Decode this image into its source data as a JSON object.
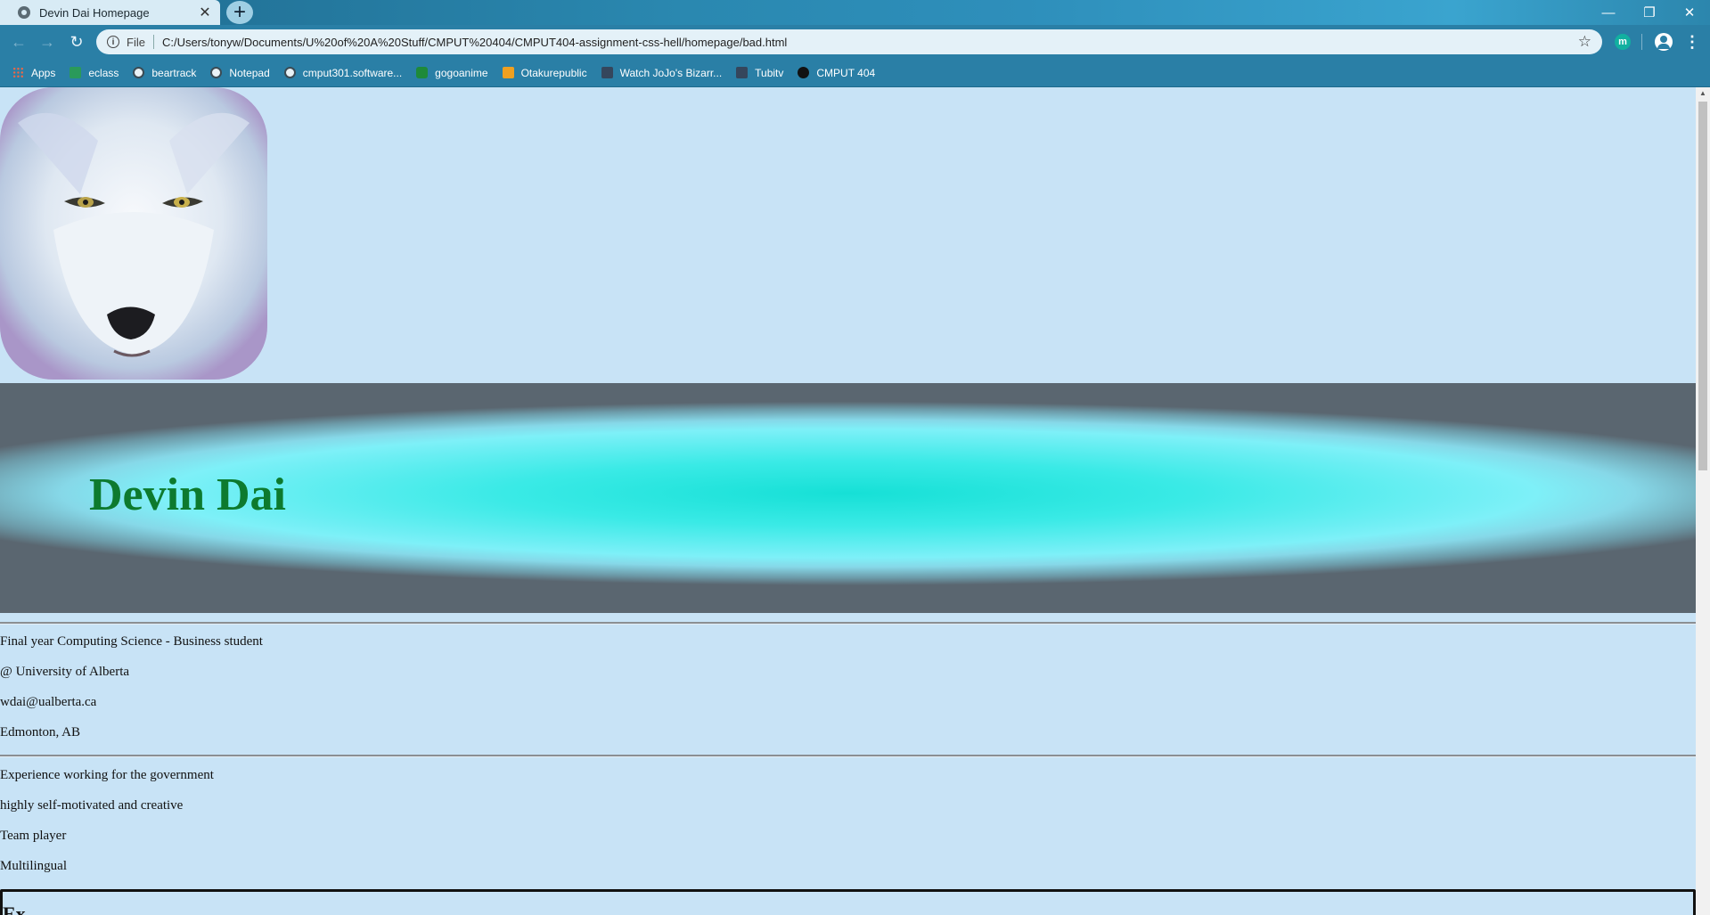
{
  "window": {
    "tab_title": "Devin Dai Homepage",
    "tab_close": "✕",
    "new_tab": "+",
    "minimize": "—",
    "restore": "❐",
    "close": "✕"
  },
  "toolbar": {
    "back": "←",
    "forward": "→",
    "reload": "↻",
    "info": "i",
    "scheme": "File",
    "url": "C:/Users/tonyw/Documents/U%20of%20A%20Stuff/CMPUT%20404/CMPUT404-assignment-css-hell/homepage/bad.html",
    "star": "☆",
    "extension_label": "m",
    "menu": "⋮"
  },
  "bookmarks": [
    {
      "label": "Apps",
      "icon": "apps-icon"
    },
    {
      "label": "eclass",
      "icon": "eclass-icon"
    },
    {
      "label": "beartrack",
      "icon": "globe-icon"
    },
    {
      "label": "Notepad",
      "icon": "globe-icon"
    },
    {
      "label": "cmput301.software...",
      "icon": "globe-icon"
    },
    {
      "label": "gogoanime",
      "icon": "tv-icon"
    },
    {
      "label": "Otakurepublic",
      "icon": "otaku-icon"
    },
    {
      "label": "Watch JoJo's Bizarr...",
      "icon": "tumblr-icon"
    },
    {
      "label": "Tubitv",
      "icon": "tumblr-icon"
    },
    {
      "label": "CMPUT 404",
      "icon": "404-icon"
    }
  ],
  "page": {
    "name": "Devin Dai",
    "contact": [
      "Final year Computing Science - Business student",
      "@ University of Alberta",
      "wdai@ualberta.ca",
      "Edmonton, AB"
    ],
    "traits": [
      "Experience working for the government",
      "highly self-motivated and creative",
      "Team player",
      "Multilingual"
    ],
    "box_heading": "Ex..."
  },
  "colors": {
    "page_background": "#c8e3f6",
    "title_color": "#0d7a2e",
    "banner_center": "#16e0d6",
    "chrome": "#2a7fa6"
  }
}
